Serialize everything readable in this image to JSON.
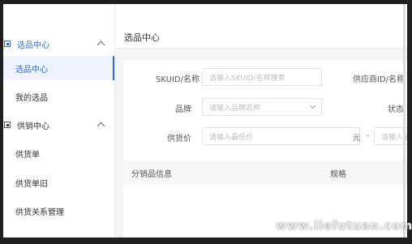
{
  "sidebar": {
    "groups": [
      {
        "label": "选品中心",
        "items": [
          {
            "label": "选品中心"
          },
          {
            "label": "我的选品"
          }
        ]
      },
      {
        "label": "供销中心",
        "items": [
          {
            "label": "供货单"
          },
          {
            "label": "供货单旧"
          },
          {
            "label": "供货关系管理"
          }
        ]
      }
    ]
  },
  "header": {
    "title": "选品中心"
  },
  "filters": {
    "sku": {
      "label": "SKUID/名称",
      "placeholder": "请输入SKUID/名称搜索"
    },
    "supplier": {
      "label": "供应商ID/名称"
    },
    "brand": {
      "label": "品牌",
      "placeholder": "请输入品牌名称"
    },
    "status": {
      "label": "状态"
    },
    "price": {
      "label": "供货价",
      "min_placeholder": "请输入最低价",
      "unit": "元",
      "separator": "-",
      "max_placeholder": "请输入最"
    }
  },
  "table": {
    "columns": [
      "分销品信息",
      "规格"
    ]
  },
  "watermark": "www.liefutuan.com"
}
